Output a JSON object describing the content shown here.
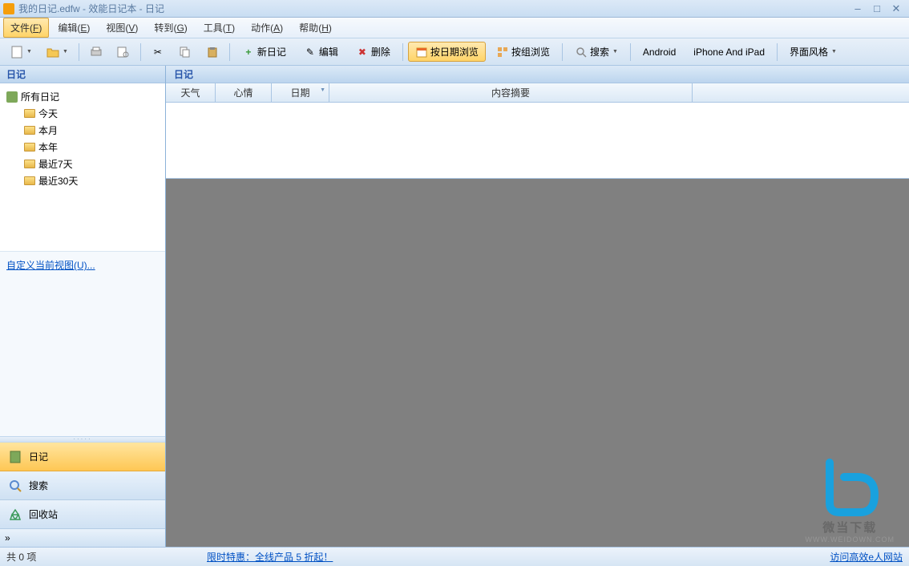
{
  "title": "我的日记.edfw - 效能日记本 - 日记",
  "menu": [
    {
      "label": "文件",
      "key": "F",
      "active": true
    },
    {
      "label": "编辑",
      "key": "E"
    },
    {
      "label": "视图",
      "key": "V"
    },
    {
      "label": "转到",
      "key": "G"
    },
    {
      "label": "工具",
      "key": "T"
    },
    {
      "label": "动作",
      "key": "A"
    },
    {
      "label": "帮助",
      "key": "H"
    }
  ],
  "toolbar": {
    "new_diary": "新日记",
    "edit": "编辑",
    "delete": "删除",
    "browse_date": "按日期浏览",
    "browse_group": "按组浏览",
    "search": "搜索",
    "android": "Android",
    "iphone": "iPhone And iPad",
    "skin": "界面风格"
  },
  "sidebar_title": "日记",
  "tree": {
    "root": "所有日记",
    "children": [
      "今天",
      "本月",
      "本年",
      "最近7天",
      "最近30天"
    ]
  },
  "custom_view": "自定义当前视图(U)...",
  "nav": {
    "diary": "日记",
    "search": "搜索",
    "recycle": "回收站"
  },
  "content_title": "日记",
  "columns": [
    "天气",
    "心情",
    "日期",
    "内容摘要"
  ],
  "status": {
    "count": "共 0 项",
    "promo": "限时特惠：全线产品 5 折起！",
    "visit": "访问高效e人网站"
  },
  "watermark": {
    "text": "微当下载",
    "url": "WWW.WEIDOWN.COM"
  }
}
